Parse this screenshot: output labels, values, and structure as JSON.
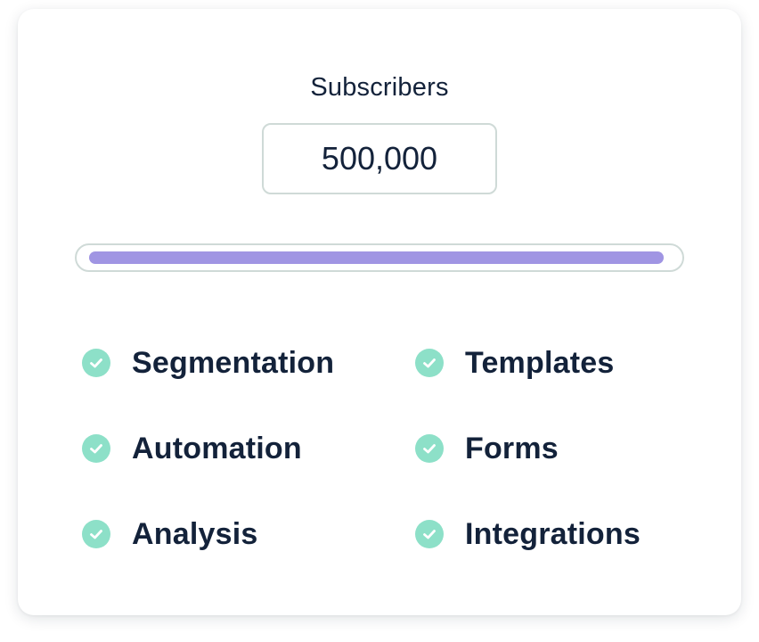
{
  "pricing": {
    "label": "Subscribers",
    "value": "500,000",
    "slider_fraction": 0.99,
    "accent_color": "#a095e3",
    "check_color": "#8de0c8"
  },
  "features": [
    {
      "label": "Segmentation",
      "icon": "check-circle-icon"
    },
    {
      "label": "Templates",
      "icon": "check-circle-icon"
    },
    {
      "label": "Automation",
      "icon": "check-circle-icon"
    },
    {
      "label": "Forms",
      "icon": "check-circle-icon"
    },
    {
      "label": "Analysis",
      "icon": "check-circle-icon"
    },
    {
      "label": "Integrations",
      "icon": "check-circle-icon"
    }
  ]
}
